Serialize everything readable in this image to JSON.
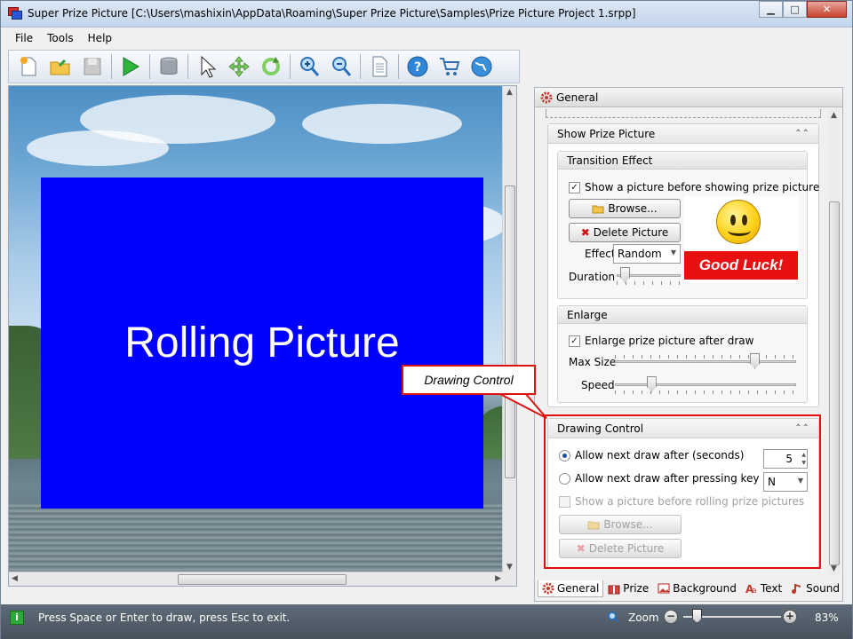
{
  "window": {
    "title": "Super Prize Picture [C:\\Users\\mashixin\\AppData\\Roaming\\Super Prize Picture\\Samples\\Prize Picture Project 1.srpp]",
    "minimize": "▁",
    "maximize": "□",
    "close": "✕"
  },
  "menu": [
    "File",
    "Tools",
    "Help"
  ],
  "toolbar": {
    "icons": [
      "new-file-icon",
      "open-folder-icon",
      "save-icon",
      "play-icon",
      "database-icon",
      "pointer-icon",
      "move-icon",
      "rotate-icon",
      "zoom-in-icon",
      "zoom-out-icon",
      "document-icon",
      "help-icon",
      "cart-icon",
      "globe-icon"
    ]
  },
  "canvas": {
    "rolling_text": "Rolling Picture",
    "box_color": "#0000ff"
  },
  "panel": {
    "header": "General",
    "show_prize": {
      "title": "Show Prize Picture",
      "collapse": "⌃⌃",
      "transition": {
        "title": "Transition Effect",
        "show_before": "Show a picture before showing prize picture",
        "browse": "Browse...",
        "delete": "Delete Picture",
        "effect_label": "Effect",
        "effect_value": "Random",
        "duration_label": "Duration",
        "preview_text": "Good Luck!"
      },
      "enlarge": {
        "title": "Enlarge",
        "enlarge_after": "Enlarge prize picture after draw",
        "max_size_label": "Max Size",
        "max_size_level": 0.77,
        "speed_label": "Speed",
        "speed_level": 0.2
      }
    },
    "drawing_control": {
      "title": "Drawing Control",
      "collapse": "⌃⌃",
      "option_seconds": "Allow next draw after (seconds)",
      "seconds_value": "5",
      "option_key": "Allow next draw after pressing key",
      "key_value": "N",
      "show_before_rolling": "Show a picture before rolling prize pictures",
      "browse": "Browse...",
      "delete": "Delete Picture"
    },
    "tabs": [
      {
        "label": "General",
        "icon": "gear-icon"
      },
      {
        "label": "Prize",
        "icon": "gift-icon"
      },
      {
        "label": "Background",
        "icon": "image-icon"
      },
      {
        "label": "Text",
        "icon": "text-icon"
      },
      {
        "label": "Sound",
        "icon": "music-note-icon"
      }
    ]
  },
  "callout": {
    "text": "Drawing Control",
    "color": "#e01010"
  },
  "status": {
    "message": "Press Space or Enter to draw, press Esc to exit.",
    "zoom_label": "Zoom",
    "zoom_value": "83%",
    "zoom_out": "−",
    "zoom_in": "+"
  }
}
